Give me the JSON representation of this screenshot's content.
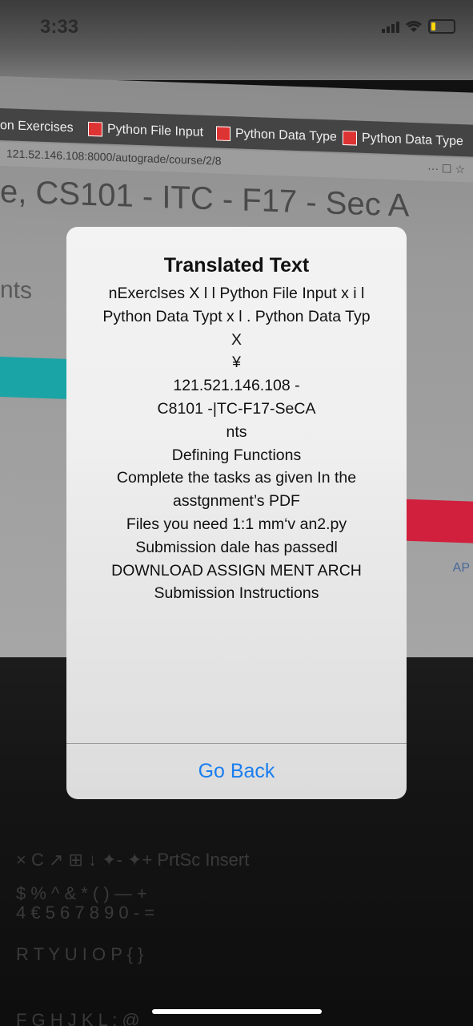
{
  "status_bar": {
    "time": "3:33"
  },
  "background": {
    "tabs": [
      {
        "label": "on Exercises"
      },
      {
        "label": "Python File Input"
      },
      {
        "label": "Python Data Type"
      },
      {
        "label": "Python Data Type"
      }
    ],
    "url": "121.52.146.108:8000/autograde/course/2/8",
    "page_title": "e, CS101 - ITC - F17 - Sec A",
    "partial_text": "nts",
    "side_text": "AP"
  },
  "dialog": {
    "title": "Translated Text",
    "lines": [
      "nExerclses X l l Python File Input x i l",
      "Python Data Typt x l . Python Data Typ",
      "X",
      "¥",
      "121.521.146.108 -",
      "C8101 -|TC-F17-SeCA",
      "nts",
      "Defining Functions",
      "Complete the tasks as given In the",
      "asstgnment’s PDF",
      "Files you need 1:1 mm‘v an2.py",
      "Submission dale has passedl",
      "DOWNLOAD ASSIGN MENT ARCH",
      "Submission Instructions"
    ],
    "button_label": "Go Back"
  },
  "keyboard_rows": [
    "× C ↗ ⊞ ↓ ✦- ✦+ PrtSc Insert",
    "$ % ^ & * ( ) — +",
    "4 € 5 6 7 8 9 0 - =",
    "R T Y U I O P { }",
    "F G H J K L ; @"
  ],
  "colors": {
    "accent": "#1a7ef0",
    "teal_banner": "#1aa4a6",
    "red_banner": "#d0203d",
    "battery": "#ffd60a"
  }
}
